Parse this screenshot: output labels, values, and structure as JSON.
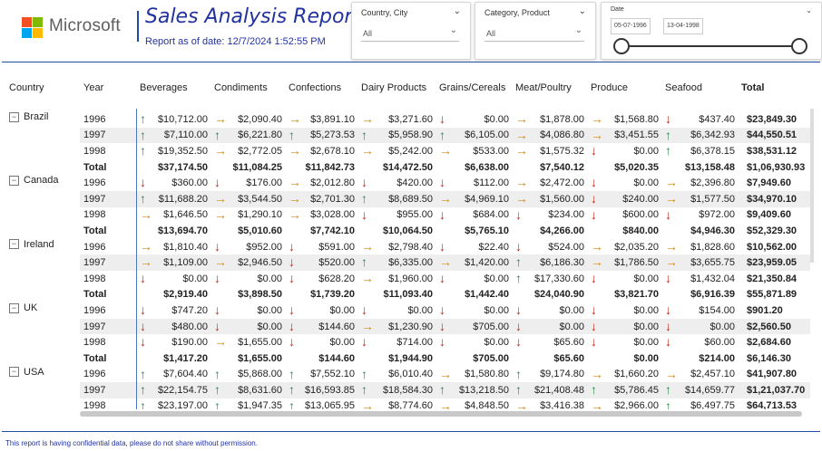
{
  "header": {
    "logo_text": "Microsoft",
    "title": "Sales Analysis Report",
    "as_of": "Report as of date: 12/7/2024 1:52:55 PM"
  },
  "slicers": {
    "country_city": {
      "label": "Country, City",
      "value": "All"
    },
    "category_product": {
      "label": "Category, Product",
      "value": "All"
    },
    "date": {
      "label": "Date",
      "start": "05-07-1996",
      "end": "13-04-1998"
    }
  },
  "matrix": {
    "columns": [
      "Country",
      "Year",
      "Beverages",
      "Condiments",
      "Confections",
      "Dairy Products",
      "Grains/Cereals",
      "Meat/Poultry",
      "Produce",
      "Seafood",
      "Total"
    ],
    "groups": [
      {
        "country": "Brazil",
        "rows": [
          {
            "year": "1996",
            "cells": [
              [
                "up",
                "$10,712.00"
              ],
              [
                "fl",
                "$2,090.40"
              ],
              [
                "fl",
                "$3,891.10"
              ],
              [
                "fl",
                "$3,271.60"
              ],
              [
                "dn",
                "$0.00"
              ],
              [
                "fl",
                "$1,878.00"
              ],
              [
                "fl",
                "$1,568.80"
              ],
              [
                "dn",
                "$437.40"
              ]
            ],
            "total": "$23,849.30"
          },
          {
            "year": "1997",
            "cells": [
              [
                "up",
                "$7,110.00"
              ],
              [
                "up",
                "$6,221.80"
              ],
              [
                "up",
                "$5,273.53"
              ],
              [
                "up",
                "$5,958.90"
              ],
              [
                "up",
                "$6,105.00"
              ],
              [
                "fl",
                "$4,086.80"
              ],
              [
                "fl",
                "$3,451.55"
              ],
              [
                "up",
                "$6,342.93"
              ]
            ],
            "total": "$44,550.51"
          },
          {
            "year": "1998",
            "cells": [
              [
                "up",
                "$19,352.50"
              ],
              [
                "fl",
                "$2,772.05"
              ],
              [
                "fl",
                "$2,678.10"
              ],
              [
                "fl",
                "$5,242.00"
              ],
              [
                "fl",
                "$533.00"
              ],
              [
                "fl",
                "$1,575.32"
              ],
              [
                "dn",
                "$0.00"
              ],
              [
                "up",
                "$6,378.15"
              ]
            ],
            "total": "$38,531.12"
          },
          {
            "year": "Total",
            "cells": [
              [
                "",
                "$37,174.50"
              ],
              [
                "",
                "$11,084.25"
              ],
              [
                "",
                "$11,842.73"
              ],
              [
                "",
                "$14,472.50"
              ],
              [
                "",
                "$6,638.00"
              ],
              [
                "",
                "$7,540.12"
              ],
              [
                "",
                "$5,020.35"
              ],
              [
                "",
                "$13,158.48"
              ]
            ],
            "total": "$1,06,930.93"
          }
        ]
      },
      {
        "country": "Canada",
        "rows": [
          {
            "year": "1996",
            "cells": [
              [
                "dn",
                "$360.00"
              ],
              [
                "dn",
                "$176.00"
              ],
              [
                "fl",
                "$2,012.80"
              ],
              [
                "dn",
                "$420.00"
              ],
              [
                "dn",
                "$112.00"
              ],
              [
                "fl",
                "$2,472.00"
              ],
              [
                "dn",
                "$0.00"
              ],
              [
                "fl",
                "$2,396.80"
              ]
            ],
            "total": "$7,949.60"
          },
          {
            "year": "1997",
            "cells": [
              [
                "up",
                "$11,688.20"
              ],
              [
                "fl",
                "$3,544.50"
              ],
              [
                "fl",
                "$2,701.30"
              ],
              [
                "up",
                "$8,689.50"
              ],
              [
                "fl",
                "$4,969.10"
              ],
              [
                "fl",
                "$1,560.00"
              ],
              [
                "dn",
                "$240.00"
              ],
              [
                "fl",
                "$1,577.50"
              ]
            ],
            "total": "$34,970.10"
          },
          {
            "year": "1998",
            "cells": [
              [
                "fl",
                "$1,646.50"
              ],
              [
                "fl",
                "$1,290.10"
              ],
              [
                "fl",
                "$3,028.00"
              ],
              [
                "dn",
                "$955.00"
              ],
              [
                "dn",
                "$684.00"
              ],
              [
                "dn",
                "$234.00"
              ],
              [
                "dn",
                "$600.00"
              ],
              [
                "dn",
                "$972.00"
              ]
            ],
            "total": "$9,409.60"
          },
          {
            "year": "Total",
            "cells": [
              [
                "",
                "$13,694.70"
              ],
              [
                "",
                "$5,010.60"
              ],
              [
                "",
                "$7,742.10"
              ],
              [
                "",
                "$10,064.50"
              ],
              [
                "",
                "$5,765.10"
              ],
              [
                "",
                "$4,266.00"
              ],
              [
                "",
                "$840.00"
              ],
              [
                "",
                "$4,946.30"
              ]
            ],
            "total": "$52,329.30"
          }
        ]
      },
      {
        "country": "Ireland",
        "rows": [
          {
            "year": "1996",
            "cells": [
              [
                "fl",
                "$1,810.40"
              ],
              [
                "dn",
                "$952.00"
              ],
              [
                "dn",
                "$591.00"
              ],
              [
                "fl",
                "$2,798.40"
              ],
              [
                "dn",
                "$22.40"
              ],
              [
                "dn",
                "$524.00"
              ],
              [
                "fl",
                "$2,035.20"
              ],
              [
                "fl",
                "$1,828.60"
              ]
            ],
            "total": "$10,562.00"
          },
          {
            "year": "1997",
            "cells": [
              [
                "fl",
                "$1,109.00"
              ],
              [
                "fl",
                "$2,946.50"
              ],
              [
                "dn",
                "$520.00"
              ],
              [
                "up",
                "$6,335.00"
              ],
              [
                "fl",
                "$1,420.00"
              ],
              [
                "up",
                "$6,186.30"
              ],
              [
                "fl",
                "$1,786.50"
              ],
              [
                "fl",
                "$3,655.75"
              ]
            ],
            "total": "$23,959.05"
          },
          {
            "year": "1998",
            "cells": [
              [
                "dn",
                "$0.00"
              ],
              [
                "dn",
                "$0.00"
              ],
              [
                "dn",
                "$628.20"
              ],
              [
                "fl",
                "$1,960.00"
              ],
              [
                "dn",
                "$0.00"
              ],
              [
                "up",
                "$17,330.60"
              ],
              [
                "dn",
                "$0.00"
              ],
              [
                "dn",
                "$1,432.04"
              ]
            ],
            "total": "$21,350.84"
          },
          {
            "year": "Total",
            "cells": [
              [
                "",
                "$2,919.40"
              ],
              [
                "",
                "$3,898.50"
              ],
              [
                "",
                "$1,739.20"
              ],
              [
                "",
                "$11,093.40"
              ],
              [
                "",
                "$1,442.40"
              ],
              [
                "",
                "$24,040.90"
              ],
              [
                "",
                "$3,821.70"
              ],
              [
                "",
                "$6,916.39"
              ]
            ],
            "total": "$55,871.89"
          }
        ]
      },
      {
        "country": "UK",
        "rows": [
          {
            "year": "1996",
            "cells": [
              [
                "dn",
                "$747.20"
              ],
              [
                "dn",
                "$0.00"
              ],
              [
                "dn",
                "$0.00"
              ],
              [
                "dn",
                "$0.00"
              ],
              [
                "dn",
                "$0.00"
              ],
              [
                "dn",
                "$0.00"
              ],
              [
                "dn",
                "$0.00"
              ],
              [
                "dn",
                "$154.00"
              ]
            ],
            "total": "$901.20"
          },
          {
            "year": "1997",
            "cells": [
              [
                "dn",
                "$480.00"
              ],
              [
                "dn",
                "$0.00"
              ],
              [
                "dn",
                "$144.60"
              ],
              [
                "fl",
                "$1,230.90"
              ],
              [
                "dn",
                "$705.00"
              ],
              [
                "dn",
                "$0.00"
              ],
              [
                "dn",
                "$0.00"
              ],
              [
                "dn",
                "$0.00"
              ]
            ],
            "total": "$2,560.50"
          },
          {
            "year": "1998",
            "cells": [
              [
                "dn",
                "$190.00"
              ],
              [
                "fl",
                "$1,655.00"
              ],
              [
                "dn",
                "$0.00"
              ],
              [
                "dn",
                "$714.00"
              ],
              [
                "dn",
                "$0.00"
              ],
              [
                "dn",
                "$65.60"
              ],
              [
                "dn",
                "$0.00"
              ],
              [
                "dn",
                "$60.00"
              ]
            ],
            "total": "$2,684.60"
          },
          {
            "year": "Total",
            "cells": [
              [
                "",
                "$1,417.20"
              ],
              [
                "",
                "$1,655.00"
              ],
              [
                "",
                "$144.60"
              ],
              [
                "",
                "$1,944.90"
              ],
              [
                "",
                "$705.00"
              ],
              [
                "",
                "$65.60"
              ],
              [
                "",
                "$0.00"
              ],
              [
                "",
                "$214.00"
              ]
            ],
            "total": "$6,146.30"
          }
        ]
      },
      {
        "country": "USA",
        "rows": [
          {
            "year": "1996",
            "cells": [
              [
                "up",
                "$7,604.40"
              ],
              [
                "up",
                "$5,868.00"
              ],
              [
                "up",
                "$7,552.10"
              ],
              [
                "up",
                "$6,010.40"
              ],
              [
                "fl",
                "$1,580.80"
              ],
              [
                "up",
                "$9,174.80"
              ],
              [
                "fl",
                "$1,660.20"
              ],
              [
                "fl",
                "$2,457.10"
              ]
            ],
            "total": "$41,907.80"
          },
          {
            "year": "1997",
            "cells": [
              [
                "up",
                "$22,154.75"
              ],
              [
                "up",
                "$8,631.60"
              ],
              [
                "up",
                "$16,593.85"
              ],
              [
                "up",
                "$18,584.30"
              ],
              [
                "up",
                "$13,218.50"
              ],
              [
                "up",
                "$21,408.48"
              ],
              [
                "up",
                "$5,786.45"
              ],
              [
                "up",
                "$14,659.77"
              ]
            ],
            "total": "$1,21,037.70"
          },
          {
            "year": "1998",
            "cells": [
              [
                "up",
                "$23,197.00"
              ],
              [
                "up",
                "$1,947.35"
              ],
              [
                "up",
                "$13,065.95"
              ],
              [
                "fl",
                "$8,774.60"
              ],
              [
                "fl",
                "$4,848.50"
              ],
              [
                "fl",
                "$3,416.38"
              ],
              [
                "fl",
                "$2,966.00"
              ],
              [
                "up",
                "$6,497.75"
              ]
            ],
            "total": "$64,713.53"
          }
        ]
      }
    ]
  },
  "footer": {
    "note": "This report is having confidential data, please do not share without permission."
  },
  "colors": {
    "up": "#2e8a4e",
    "down": "#c0281b",
    "flat": "#d68a14",
    "title": "#2233a0",
    "accent_line": "#1f4ea1"
  },
  "icons": {
    "up": "arrow-up-icon",
    "down": "arrow-down-icon",
    "flat": "arrow-right-icon"
  }
}
